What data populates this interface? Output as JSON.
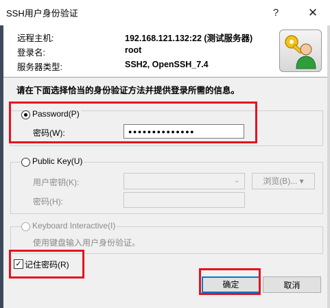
{
  "window": {
    "title": "SSH用户身份验证",
    "help": "?",
    "close": "✕"
  },
  "info": {
    "host_label": "远程主机:",
    "host_value": "192.168.121.132:22 (测试服务器)",
    "user_label": "登录名:",
    "user_value": "root",
    "type_label": "服务器类型:",
    "type_value": "SSH2, OpenSSH_7.4"
  },
  "instruction": "请在下面选择恰当的身份验证方法并提供登录所需的信息。",
  "password_method": {
    "label": "Password(P)",
    "field_label": "密码(W):",
    "value": "●●●●●●●●●●●●●●"
  },
  "publickey_method": {
    "label": "Public Key(U)",
    "key_label": "用户密钥(K):",
    "browse_label": "浏览(B)... ▾",
    "pass_label": "密码(H):"
  },
  "keyboard_method": {
    "label": "Keyboard Interactive(I)",
    "desc": "使用键盘输入用户身份验证。"
  },
  "remember": {
    "label": "记住密码(R)",
    "checked": true
  },
  "buttons": {
    "ok": "确定",
    "cancel": "取消"
  },
  "icon": "keys-user-icon",
  "colors": {
    "highlight": "#e5111f",
    "accent": "#0078d7"
  }
}
